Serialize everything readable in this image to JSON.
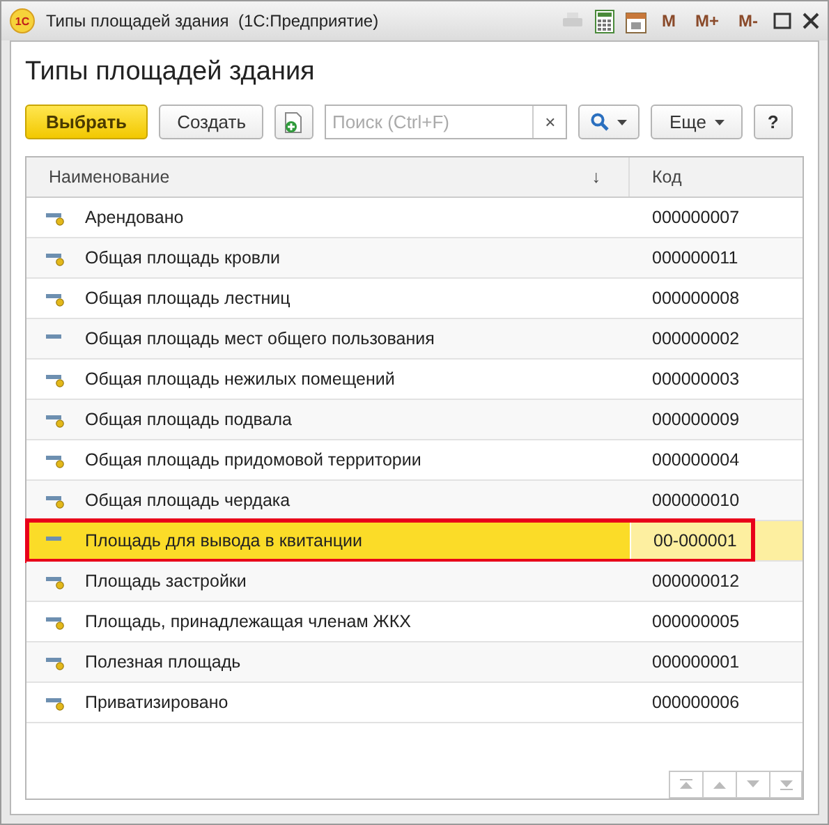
{
  "window": {
    "title": "Типы площадей здания  (1С:Предприятие)",
    "app_icon": "1С",
    "title_buttons": [
      "M",
      "M+",
      "M-"
    ]
  },
  "heading": "Типы площадей здания",
  "toolbar": {
    "select_button": "Выбрать",
    "create_button": "Создать",
    "search": {
      "placeholder": "Поиск (Ctrl+F)",
      "clear": "×"
    },
    "more_button": "Еще",
    "help_button": "?"
  },
  "table": {
    "columns": [
      {
        "label": "Наименование",
        "sort": "↓"
      },
      {
        "label": "Код"
      }
    ],
    "rows": [
      {
        "kind": "marked",
        "name": "Арендовано",
        "code": "000000007",
        "selected": false,
        "outlined": false
      },
      {
        "kind": "marked",
        "name": "Общая площадь кровли",
        "code": "000000011",
        "selected": false,
        "outlined": false
      },
      {
        "kind": "marked",
        "name": "Общая площадь лестниц",
        "code": "000000008",
        "selected": false,
        "outlined": false
      },
      {
        "kind": "plain",
        "name": "Общая площадь мест общего пользования",
        "code": "000000002",
        "selected": false,
        "outlined": false
      },
      {
        "kind": "marked",
        "name": "Общая площадь нежилых помещений",
        "code": "000000003",
        "selected": false,
        "outlined": false
      },
      {
        "kind": "marked",
        "name": "Общая площадь подвала",
        "code": "000000009",
        "selected": false,
        "outlined": false
      },
      {
        "kind": "marked",
        "name": "Общая площадь придомовой территории",
        "code": "000000004",
        "selected": false,
        "outlined": false
      },
      {
        "kind": "marked",
        "name": "Общая площадь чердака",
        "code": "000000010",
        "selected": false,
        "outlined": false
      },
      {
        "kind": "plain",
        "name": "Площадь для вывода в квитанции",
        "code": "00-000001",
        "selected": true,
        "outlined": true
      },
      {
        "kind": "marked",
        "name": "Площадь застройки",
        "code": "000000012",
        "selected": false,
        "outlined": false
      },
      {
        "kind": "marked",
        "name": "Площадь, принадлежащая членам ЖКХ",
        "code": "000000005",
        "selected": false,
        "outlined": false
      },
      {
        "kind": "marked",
        "name": "Полезная площадь",
        "code": "000000001",
        "selected": false,
        "outlined": false
      },
      {
        "kind": "marked",
        "name": "Приватизировано",
        "code": "000000006",
        "selected": false,
        "outlined": false
      }
    ]
  }
}
